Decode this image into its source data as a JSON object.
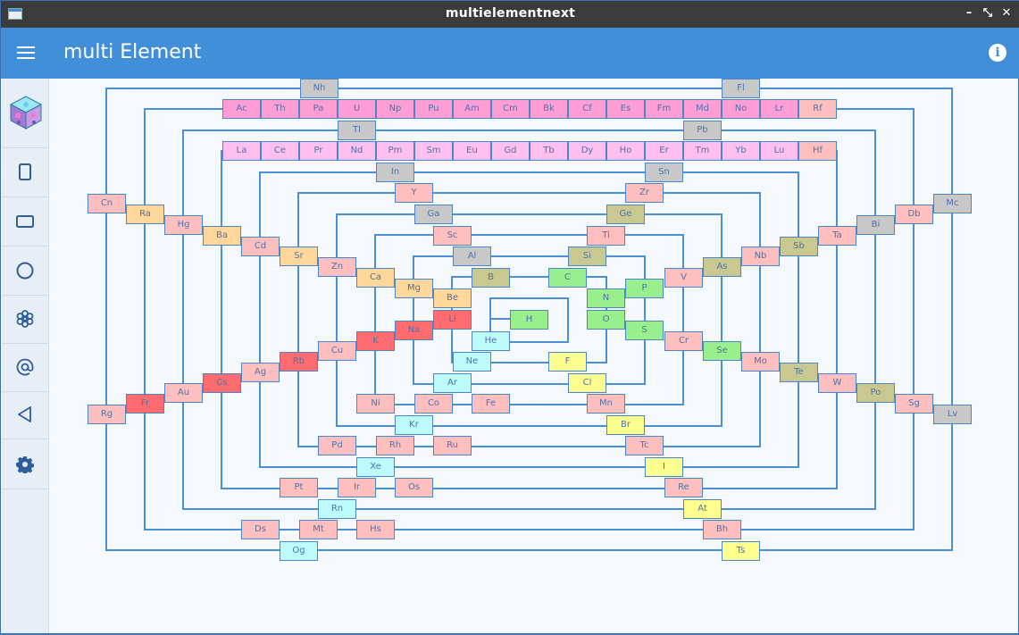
{
  "window": {
    "title": "multielementnext",
    "minimize": "–",
    "restore": "⤡",
    "close": "✕"
  },
  "toolbar": {
    "title": "multi Element",
    "info_label": "i"
  },
  "sidebar": {
    "items": [
      {
        "name": "cube-logo-icon"
      },
      {
        "name": "portrait-icon"
      },
      {
        "name": "landscape-icon"
      },
      {
        "name": "circle-icon"
      },
      {
        "name": "flower-icon"
      },
      {
        "name": "at-icon"
      },
      {
        "name": "back-triangle-icon"
      },
      {
        "name": "settings-gear-icon"
      }
    ]
  },
  "colors": {
    "alkali": "#ff6b6e",
    "alkaline": "#ffd79a",
    "transition": "#ffbfbf",
    "lanthanide": "#ffbfef",
    "actinide": "#ff9ed6",
    "metalloid": "#c8c890",
    "poor": "#c8c8c8",
    "nonmetal": "#99ef8d",
    "halogen": "#ffff90",
    "noble": "#bdfbff",
    "line": "#4a90d6"
  },
  "elements": [
    {
      "s": "Nh",
      "c": "poor"
    },
    {
      "s": "Fl",
      "c": "poor"
    },
    {
      "s": "Ac",
      "c": "actinide"
    },
    {
      "s": "Th",
      "c": "actinide"
    },
    {
      "s": "Pa",
      "c": "actinide"
    },
    {
      "s": "U",
      "c": "actinide"
    },
    {
      "s": "Np",
      "c": "actinide"
    },
    {
      "s": "Pu",
      "c": "actinide"
    },
    {
      "s": "Am",
      "c": "actinide"
    },
    {
      "s": "Cm",
      "c": "actinide"
    },
    {
      "s": "Bk",
      "c": "actinide"
    },
    {
      "s": "Cf",
      "c": "actinide"
    },
    {
      "s": "Es",
      "c": "actinide"
    },
    {
      "s": "Fm",
      "c": "actinide"
    },
    {
      "s": "Md",
      "c": "actinide"
    },
    {
      "s": "No",
      "c": "actinide"
    },
    {
      "s": "Lr",
      "c": "actinide"
    },
    {
      "s": "Rf",
      "c": "transition"
    },
    {
      "s": "Tl",
      "c": "poor"
    },
    {
      "s": "Pb",
      "c": "poor"
    },
    {
      "s": "La",
      "c": "lanthanide"
    },
    {
      "s": "Ce",
      "c": "lanthanide"
    },
    {
      "s": "Pr",
      "c": "lanthanide"
    },
    {
      "s": "Nd",
      "c": "lanthanide"
    },
    {
      "s": "Pm",
      "c": "lanthanide"
    },
    {
      "s": "Sm",
      "c": "lanthanide"
    },
    {
      "s": "Eu",
      "c": "lanthanide"
    },
    {
      "s": "Gd",
      "c": "lanthanide"
    },
    {
      "s": "Tb",
      "c": "lanthanide"
    },
    {
      "s": "Dy",
      "c": "lanthanide"
    },
    {
      "s": "Ho",
      "c": "lanthanide"
    },
    {
      "s": "Er",
      "c": "lanthanide"
    },
    {
      "s": "Tm",
      "c": "lanthanide"
    },
    {
      "s": "Yb",
      "c": "lanthanide"
    },
    {
      "s": "Lu",
      "c": "lanthanide"
    },
    {
      "s": "Hf",
      "c": "transition"
    },
    {
      "s": "In",
      "c": "poor"
    },
    {
      "s": "Sn",
      "c": "poor"
    },
    {
      "s": "Y",
      "c": "transition"
    },
    {
      "s": "Zr",
      "c": "transition"
    },
    {
      "s": "Cn",
      "c": "transition"
    },
    {
      "s": "Mc",
      "c": "poor"
    },
    {
      "s": "Ra",
      "c": "alkaline"
    },
    {
      "s": "Db",
      "c": "transition"
    },
    {
      "s": "Ga",
      "c": "poor"
    },
    {
      "s": "Ge",
      "c": "metalloid"
    },
    {
      "s": "Hg",
      "c": "transition"
    },
    {
      "s": "Bi",
      "c": "poor"
    },
    {
      "s": "Ba",
      "c": "alkaline"
    },
    {
      "s": "Ta",
      "c": "transition"
    },
    {
      "s": "Sc",
      "c": "transition"
    },
    {
      "s": "Ti",
      "c": "transition"
    },
    {
      "s": "Cd",
      "c": "transition"
    },
    {
      "s": "Sb",
      "c": "metalloid"
    },
    {
      "s": "Sr",
      "c": "alkaline"
    },
    {
      "s": "Nb",
      "c": "transition"
    },
    {
      "s": "Al",
      "c": "poor"
    },
    {
      "s": "Si",
      "c": "metalloid"
    },
    {
      "s": "Zn",
      "c": "transition"
    },
    {
      "s": "As",
      "c": "metalloid"
    },
    {
      "s": "Ca",
      "c": "alkaline"
    },
    {
      "s": "B",
      "c": "metalloid"
    },
    {
      "s": "C",
      "c": "nonmetal"
    },
    {
      "s": "V",
      "c": "transition"
    },
    {
      "s": "Mg",
      "c": "alkaline"
    },
    {
      "s": "P",
      "c": "nonmetal"
    },
    {
      "s": "Be",
      "c": "alkaline"
    },
    {
      "s": "N",
      "c": "nonmetal"
    },
    {
      "s": "Li",
      "c": "alkali"
    },
    {
      "s": "H",
      "c": "nonmetal"
    },
    {
      "s": "Na",
      "c": "alkali"
    },
    {
      "s": "O",
      "c": "nonmetal"
    },
    {
      "s": "S",
      "c": "nonmetal"
    },
    {
      "s": "K",
      "c": "alkali"
    },
    {
      "s": "He",
      "c": "noble"
    },
    {
      "s": "Cr",
      "c": "transition"
    },
    {
      "s": "Cu",
      "c": "transition"
    },
    {
      "s": "Se",
      "c": "nonmetal"
    },
    {
      "s": "Rb",
      "c": "alkali"
    },
    {
      "s": "Ne",
      "c": "noble"
    },
    {
      "s": "F",
      "c": "halogen"
    },
    {
      "s": "Mo",
      "c": "transition"
    },
    {
      "s": "Ag",
      "c": "transition"
    },
    {
      "s": "Te",
      "c": "metalloid"
    },
    {
      "s": "Cs",
      "c": "alkali"
    },
    {
      "s": "Ar",
      "c": "noble"
    },
    {
      "s": "Cl",
      "c": "halogen"
    },
    {
      "s": "W",
      "c": "transition"
    },
    {
      "s": "Au",
      "c": "transition"
    },
    {
      "s": "Po",
      "c": "metalloid"
    },
    {
      "s": "Fr",
      "c": "alkali"
    },
    {
      "s": "Ni",
      "c": "transition"
    },
    {
      "s": "Co",
      "c": "transition"
    },
    {
      "s": "Fe",
      "c": "transition"
    },
    {
      "s": "Mn",
      "c": "transition"
    },
    {
      "s": "Sg",
      "c": "transition"
    },
    {
      "s": "Rg",
      "c": "transition"
    },
    {
      "s": "Lv",
      "c": "poor"
    },
    {
      "s": "Kr",
      "c": "noble"
    },
    {
      "s": "Br",
      "c": "halogen"
    },
    {
      "s": "Pd",
      "c": "transition"
    },
    {
      "s": "Rh",
      "c": "transition"
    },
    {
      "s": "Ru",
      "c": "transition"
    },
    {
      "s": "Tc",
      "c": "transition"
    },
    {
      "s": "Xe",
      "c": "noble"
    },
    {
      "s": "I",
      "c": "halogen"
    },
    {
      "s": "Pt",
      "c": "transition"
    },
    {
      "s": "Ir",
      "c": "transition"
    },
    {
      "s": "Os",
      "c": "transition"
    },
    {
      "s": "Re",
      "c": "transition"
    },
    {
      "s": "Rn",
      "c": "noble"
    },
    {
      "s": "At",
      "c": "halogen"
    },
    {
      "s": "Ds",
      "c": "transition"
    },
    {
      "s": "Mt",
      "c": "transition"
    },
    {
      "s": "Hs",
      "c": "transition"
    },
    {
      "s": "Bh",
      "c": "transition"
    },
    {
      "s": "Og",
      "c": "noble"
    },
    {
      "s": "Ts",
      "c": "halogen"
    }
  ]
}
